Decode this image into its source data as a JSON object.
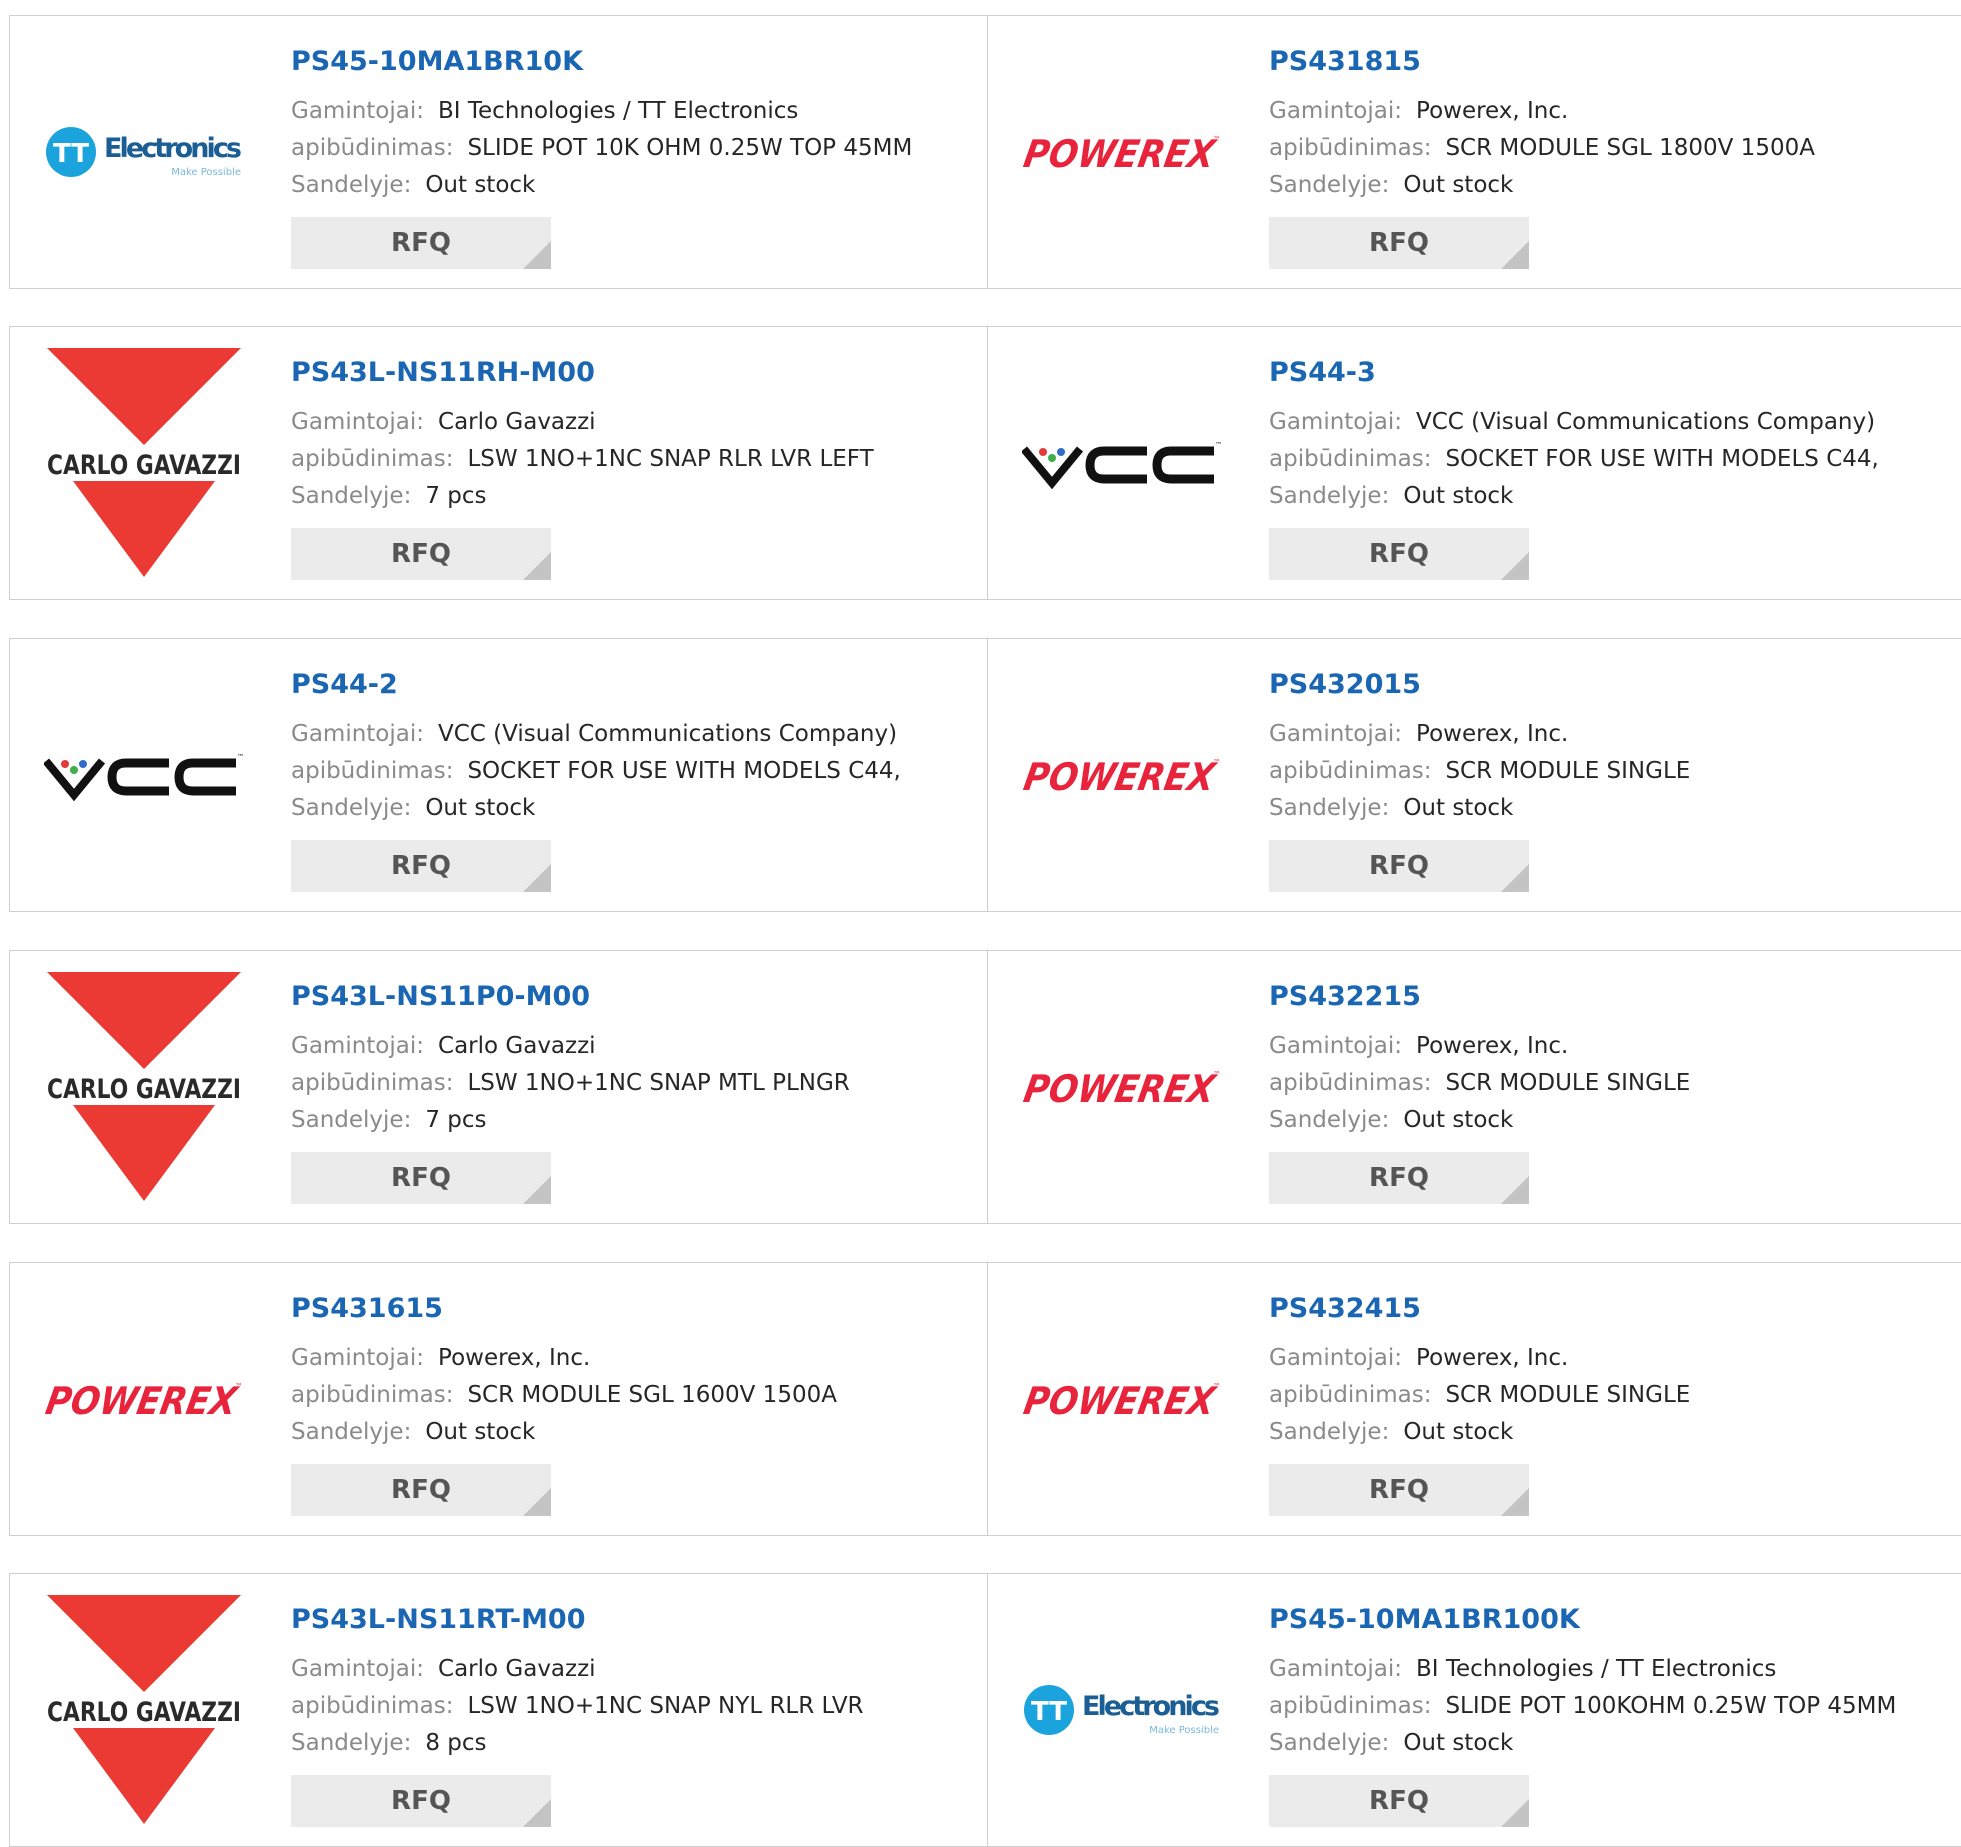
{
  "labels": {
    "manufacturer": "Gamintojai:",
    "description": "apibūdinimas:",
    "stock": "Sandelyje:",
    "rfq": "RFQ"
  },
  "brands": {
    "tt": {
      "main": "Electronics",
      "mark": "TT",
      "tagline": "Make Possible",
      "color": "#1aa3dc"
    },
    "powerex": {
      "main": "POWEREX",
      "tm": "™",
      "color": "#e8243c"
    },
    "carlo": {
      "main": "CARLO GAVAZZI",
      "color": "#ea3a33"
    },
    "vcc": {
      "main": "VCC",
      "tm": "™"
    }
  },
  "products": [
    {
      "pn": "PS45-10MA1BR10K",
      "manufacturer": "BI Technologies / TT Electronics",
      "description": "SLIDE POT 10K OHM 0.25W TOP 45MM",
      "stock": "Out stock",
      "logo": "tt"
    },
    {
      "pn": "PS431815",
      "manufacturer": "Powerex, Inc.",
      "description": "SCR MODULE SGL 1800V 1500A",
      "stock": "Out stock",
      "logo": "powerex"
    },
    {
      "pn": "PS43L-NS11RH-M00",
      "manufacturer": "Carlo Gavazzi",
      "description": "LSW 1NO+1NC SNAP RLR LVR LEFT",
      "stock": "7 pcs",
      "logo": "carlo"
    },
    {
      "pn": "PS44-3",
      "manufacturer": "VCC (Visual Communications Company)",
      "description": "SOCKET FOR USE WITH MODELS C44,",
      "stock": "Out stock",
      "logo": "vcc"
    },
    {
      "pn": "PS44-2",
      "manufacturer": "VCC (Visual Communications Company)",
      "description": "SOCKET FOR USE WITH MODELS C44,",
      "stock": "Out stock",
      "logo": "vcc"
    },
    {
      "pn": "PS432015",
      "manufacturer": "Powerex, Inc.",
      "description": "SCR MODULE SINGLE",
      "stock": "Out stock",
      "logo": "powerex"
    },
    {
      "pn": "PS43L-NS11P0-M00",
      "manufacturer": "Carlo Gavazzi",
      "description": "LSW 1NO+1NC SNAP MTL PLNGR",
      "stock": "7 pcs",
      "logo": "carlo"
    },
    {
      "pn": "PS432215",
      "manufacturer": "Powerex, Inc.",
      "description": "SCR MODULE SINGLE",
      "stock": "Out stock",
      "logo": "powerex"
    },
    {
      "pn": "PS431615",
      "manufacturer": "Powerex, Inc.",
      "description": "SCR MODULE SGL 1600V 1500A",
      "stock": "Out stock",
      "logo": "powerex"
    },
    {
      "pn": "PS432415",
      "manufacturer": "Powerex, Inc.",
      "description": "SCR MODULE SINGLE",
      "stock": "Out stock",
      "logo": "powerex"
    },
    {
      "pn": "PS43L-NS11RT-M00",
      "manufacturer": "Carlo Gavazzi",
      "description": "LSW 1NO+1NC SNAP NYL RLR LVR",
      "stock": "8 pcs",
      "logo": "carlo"
    },
    {
      "pn": "PS45-10MA1BR100K",
      "manufacturer": "BI Technologies / TT Electronics",
      "description": "SLIDE POT 100KOHM 0.25W TOP 45MM",
      "stock": "Out stock",
      "logo": "tt"
    }
  ]
}
